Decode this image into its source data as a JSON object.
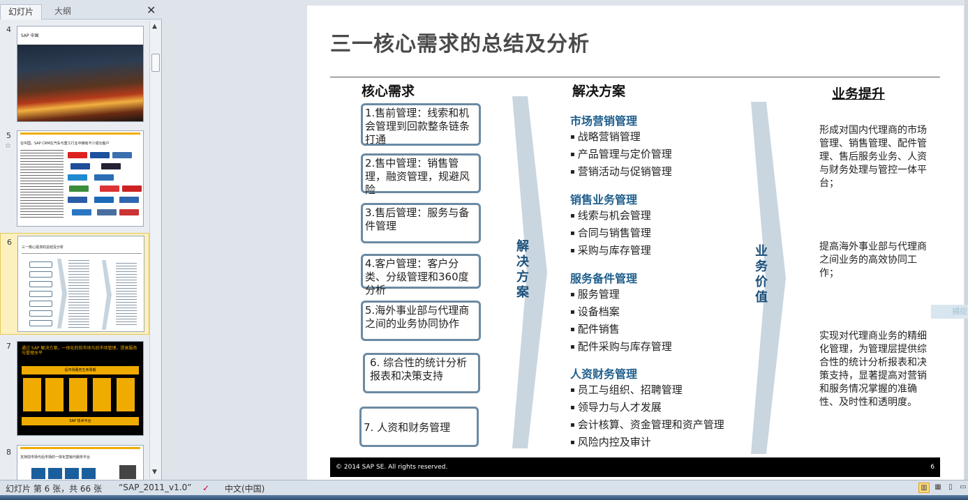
{
  "panel": {
    "tab_slides": "幻灯片",
    "tab_outline": "大纲",
    "close": "✕"
  },
  "thumbnails": [
    {
      "num": "4",
      "title": "SAP 中国"
    },
    {
      "num": "5",
      "title": "在中国，SAP CRM在汽车与重工行业中拥有不少成功客户"
    },
    {
      "num": "6",
      "title": "三一核心需求的总结及分析"
    },
    {
      "num": "7",
      "title": "通过 SAP 解决方案，一体化的前市场与后市场管理，提高服务与管理水平"
    },
    {
      "num": "8",
      "title": "支持前市场与后市场的一体化营销与服务平台"
    }
  ],
  "thumb7": {
    "band_top": "后市场服务生命周期",
    "band_bottom": "SAP 技术平台"
  },
  "slide": {
    "title": "三一核心需求的总结及分析",
    "head_core": "核心需求",
    "head_solution": "解决方案",
    "head_biz": "业务提升",
    "needs": [
      "1.售前管理：线索和机会管理到回款整条链条打通",
      "2.售中管理：销售管理，融资管理，规避风险",
      "3.售后管理：服务与备件管理",
      "4.客户管理：客户分类、分级管理和360度分析",
      "5.海外事业部与代理商之间的业务协同协作",
      "6. 综合性的统计分析报表和决策支持",
      "7. 人资和财务管理"
    ],
    "chev1_label": "解决方案",
    "chev2_label": "业务价值",
    "solutions": [
      {
        "head": "市场营销管理",
        "items": [
          "战略营销管理",
          "产品管理与定价管理",
          "营销活动与促销管理"
        ]
      },
      {
        "head": "销售业务管理",
        "items": [
          "线索与机会管理",
          "合同与销售管理",
          "采购与库存管理"
        ]
      },
      {
        "head": "服务备件管理",
        "items": [
          "服务管理",
          "设备档案",
          "配件销售",
          "配件采购与库存管理"
        ]
      },
      {
        "head": "人资财务管理",
        "items": [
          "员工与组织、招聘管理",
          "领导力与人才发展",
          "会计核算、资金管理和资产管理",
          "风险内控及审计"
        ]
      }
    ],
    "biz": [
      "形成对国内代理商的市场管理、销售管理、配件管理、售后服务业务、人资与财务处理与管控一体平台；",
      "提高海外事业部与代理商之间业务的高效协同工作；",
      "实现对代理商业务的精细化管理，为管理层提供综合性的统计分析报表和决策支持，显著提高对营销和服务情况掌握的准确性、及时性和透明度。"
    ],
    "footer_copy": "©  2014 SAP SE. All rights reserved.",
    "footer_page": "6"
  },
  "side_tab": "捕捉",
  "status": {
    "slide_info": "幻灯片 第 6 张，共 66 张",
    "theme": "“SAP_2011_v1.0”",
    "language": "中文(中国)"
  }
}
